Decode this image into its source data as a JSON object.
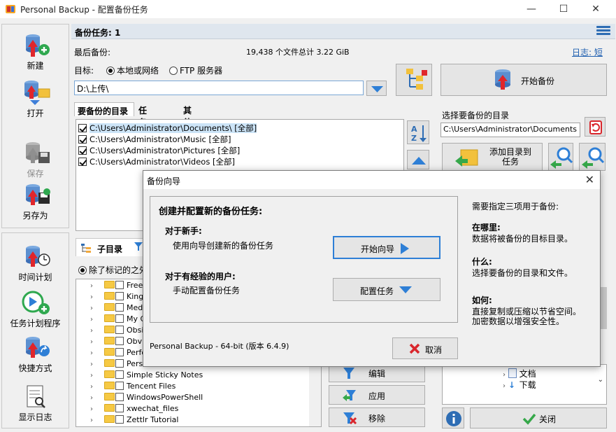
{
  "window": {
    "title": "Personal Backup - 配置备份任务",
    "minimize": "—",
    "maximize": "☐",
    "close": "✕"
  },
  "toolbar": {
    "new": "新建",
    "open": "打开",
    "save": "保存",
    "save_as": "另存为",
    "schedule": "时间计划",
    "task_scheduler": "任务计划程序",
    "shortcut": "快捷方式",
    "show_log": "显示日志"
  },
  "header": {
    "task_label": "备份任务: 1"
  },
  "info": {
    "last_backup_label": "最后备份:",
    "summary": "19,438 个文件总计 3.22 GiB",
    "log_link": "日志: 短",
    "target_label": "目标:",
    "target_local": "本地或网络",
    "target_ftp": "FTP 服务器",
    "target_path": "D:\\上传\\",
    "start_backup": "开始备份"
  },
  "tabs": [
    "要备份的目录",
    "任务设置",
    "其他选项"
  ],
  "dirs": [
    "C:\\Users\\Administrator\\Documents\\ [全部]",
    "C:\\Users\\Administrator\\Music [全部]",
    "C:\\Users\\Administrator\\Pictures [全部]",
    "C:\\Users\\Administrator\\Videos [全部]"
  ],
  "subpanel": {
    "subdir_tab": "子目录",
    "except_label": "除了标记的之外"
  },
  "tree_items": [
    "Freecad",
    "Kingsoft",
    "Media",
    "My Games",
    "Obsidian",
    "Obvious",
    "Perforce",
    "Personal",
    "Simple Sticky Notes",
    "Tencent Files",
    "WindowsPowerShell",
    "xwechat_files",
    "Zettlr Tutorial"
  ],
  "filter_buttons": {
    "edit": "编辑",
    "apply": "应用",
    "remove": "移除"
  },
  "right": {
    "select_label": "选择要备份的目录",
    "select_path": "C:\\Users\\Administrator\\Documents",
    "add_to_task": "添加目录到\n任务",
    "tree_docs": "文档",
    "tree_downloads": "下载",
    "close_button": "关闭"
  },
  "dialog": {
    "title": "备份向导",
    "heading": "创建并配置新的备份任务:",
    "newbie_title": "对于新手:",
    "newbie_desc": "使用向导创建新的备份任务",
    "start_wizard": "开始向导",
    "expert_title": "对于有经验的用户:",
    "expert_desc": "手动配置备份任务",
    "config_task": "配置任务",
    "version": "Personal Backup - 64-bit (版本 6.4.9)",
    "cancel": "取消",
    "help_intro": "需要指定三项用于备份:",
    "where_title": "在哪里:",
    "where_desc": "数据将被备份的目标目录。",
    "what_title": "什么:",
    "what_desc": "选择要备份的目录和文件。",
    "how_title": "如何:",
    "how_desc1": "直接复制或压缩以节省空间。",
    "how_desc2": "加密数据以增强安全性。"
  },
  "colors": {
    "accent_blue": "#2e7fd6",
    "header_bg": "#dfe6ee",
    "selection": "#cce4f7",
    "cancel_red": "#d9262c",
    "arrow_green": "#36a84a"
  }
}
